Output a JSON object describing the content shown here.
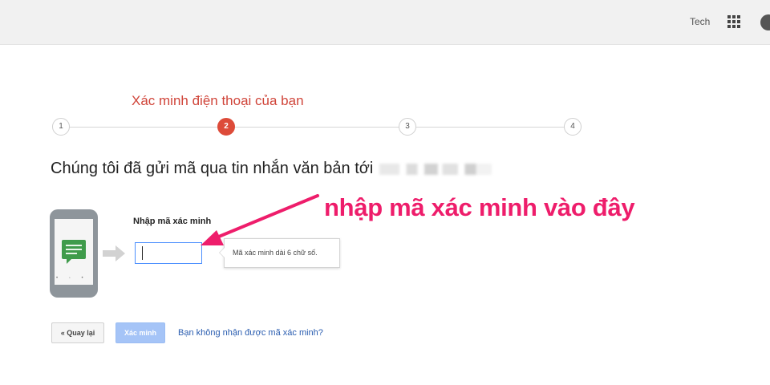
{
  "topbar": {
    "user_label": "Tech",
    "apps_icon": "apps-grid-icon",
    "avatar_icon": "avatar-icon"
  },
  "stepper": {
    "title": "Xác minh điện thoại của bạn",
    "steps": [
      "1",
      "2",
      "3",
      "4"
    ],
    "active_step": 2,
    "active_color": "#dd4b39"
  },
  "main": {
    "headline": "Chúng tôi đã gửi mã qua tin nhắn văn bản tới",
    "phone_illustration_icon": "phone-message-icon",
    "code_label": "Nhập mã xác minh",
    "code_value": "",
    "tooltip": "Mã xác minh dài 6 chữ số.",
    "annotation": "nhập mã xác minh vào đây",
    "annotation_color": "#ee1d6b"
  },
  "actions": {
    "back_label": "« Quay lại",
    "verify_label": "Xác minh",
    "no_code_link": "Bạn không nhận được mã xác minh?",
    "link_color": "#2a5db0"
  }
}
